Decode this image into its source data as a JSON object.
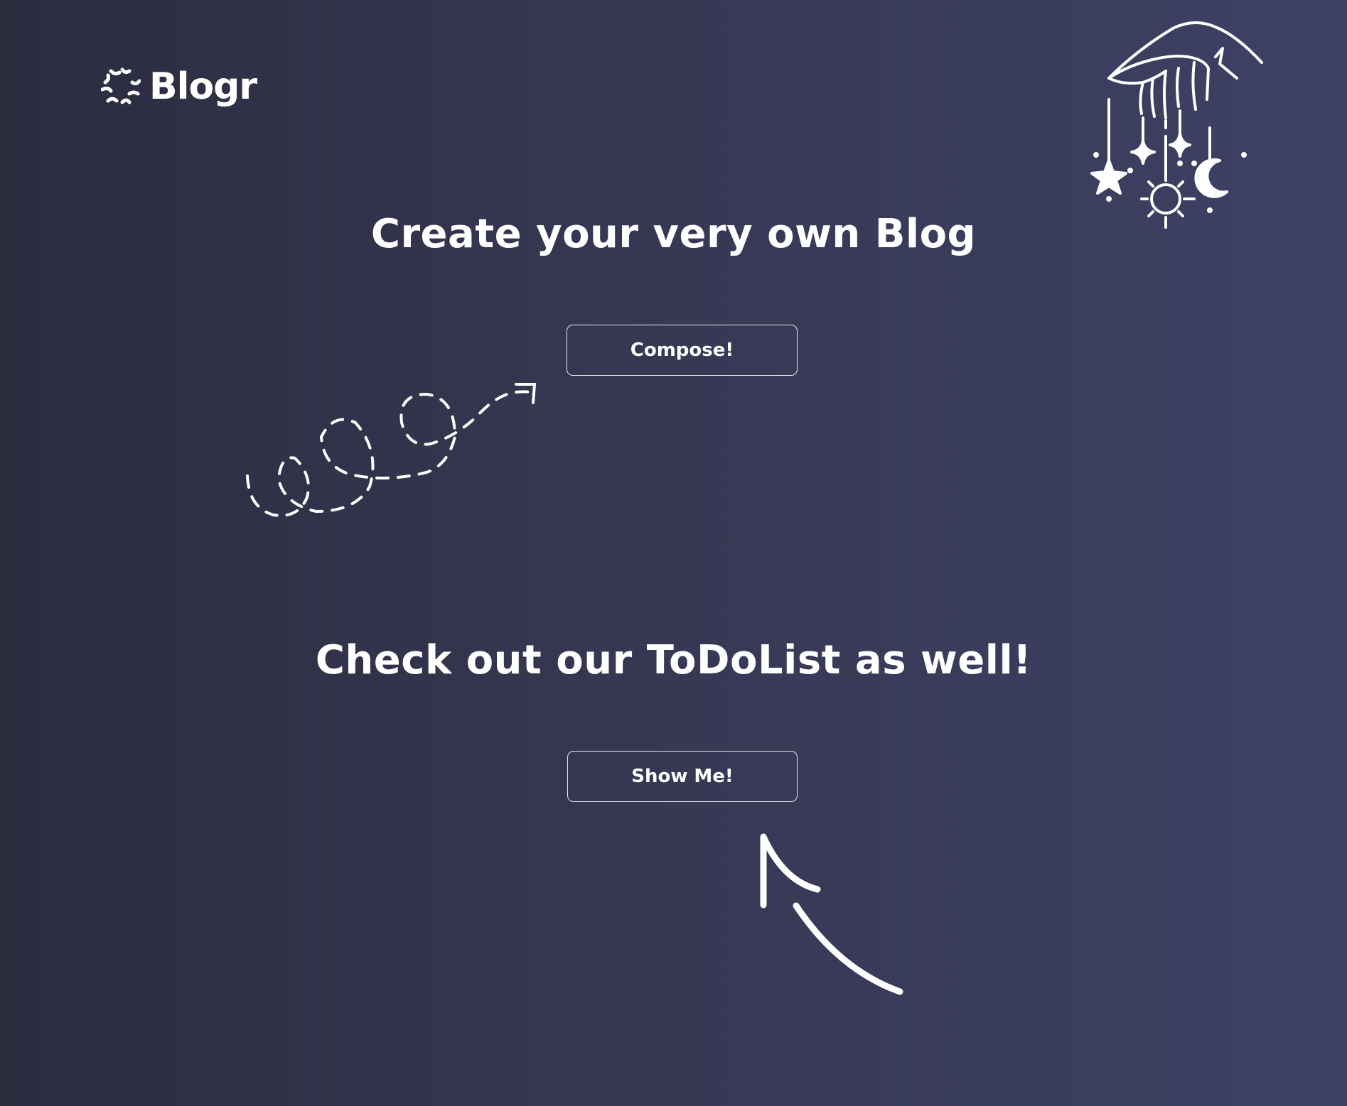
{
  "brand": {
    "name": "Blogr",
    "logo_icon": "burst-icon"
  },
  "sections": [
    {
      "heading": "Create your very own Blog",
      "button_label": "Compose!"
    },
    {
      "heading": "Check out our ToDoList as well!",
      "button_label": "Show Me!"
    }
  ],
  "decorations": {
    "hero_ornament": "hand-with-hanging-celestial-charms-icon",
    "loops": "dashed-loopy-arrow-icon",
    "arrow": "curved-arrow-icon"
  },
  "colors": {
    "background_start": "#2c2c3f",
    "background_end": "#3e4165",
    "foreground": "#ffffff"
  }
}
